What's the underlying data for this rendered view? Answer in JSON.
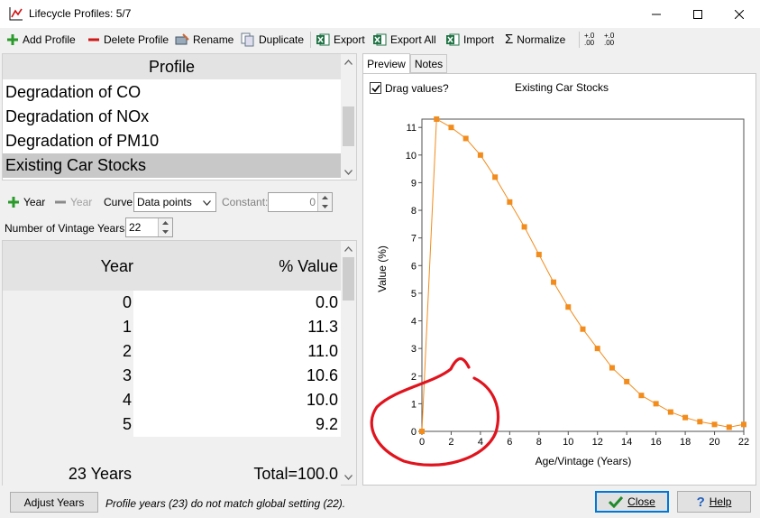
{
  "window": {
    "title": "Lifecycle Profiles: 5/7"
  },
  "toolbar": {
    "add_profile": "Add Profile",
    "delete_profile": "Delete Profile",
    "rename": "Rename",
    "duplicate": "Duplicate",
    "export": "Export",
    "export_all": "Export All",
    "import": "Import",
    "normalize": "Normalize",
    "dec_decimals": "+.0 .00",
    "inc_decimals": "+.0 .00"
  },
  "profiles": {
    "header": "Profile",
    "items": [
      "Degradation of CO",
      "Degradation of NOx",
      "Degradation of PM10",
      "Existing Car Stocks"
    ],
    "selected_index": 3
  },
  "year_toolbar": {
    "add_year": "Year",
    "remove_year": "Year",
    "curve_label": "Curve:",
    "curve_value": "Data points",
    "constant_label": "Constant:",
    "constant_value": "0"
  },
  "vintage": {
    "label": "Number of Vintage Years:",
    "value": "22"
  },
  "table": {
    "col_year": "Year",
    "col_value": "% Value",
    "rows": [
      {
        "year": "0",
        "value": "0.0"
      },
      {
        "year": "1",
        "value": "11.3"
      },
      {
        "year": "2",
        "value": "11.0"
      },
      {
        "year": "3",
        "value": "10.6"
      },
      {
        "year": "4",
        "value": "10.0"
      },
      {
        "year": "5",
        "value": "9.2"
      }
    ],
    "footer_years": "23 Years",
    "footer_total": "Total=100.0"
  },
  "tabs": {
    "preview": "Preview",
    "notes": "Notes"
  },
  "preview": {
    "drag_label": "Drag values?",
    "drag_checked": true
  },
  "chart_data": {
    "type": "line",
    "title": "Existing Car Stocks",
    "xlabel": "Age/Vintage (Years)",
    "ylabel": "Value (%)",
    "xlim": [
      0,
      22
    ],
    "ylim": [
      0,
      11.3
    ],
    "xticks": [
      0,
      2,
      4,
      6,
      8,
      10,
      12,
      14,
      16,
      18,
      20,
      22
    ],
    "yticks": [
      0,
      1,
      2,
      3,
      4,
      5,
      6,
      7,
      8,
      9,
      10,
      11
    ],
    "series": [
      {
        "color": "#f28c1c",
        "x": [
          0,
          1,
          2,
          3,
          4,
          5,
          6,
          7,
          8,
          9,
          10,
          11,
          12,
          13,
          14,
          15,
          16,
          17,
          18,
          19,
          20,
          21,
          22
        ],
        "y": [
          0.0,
          11.3,
          11.0,
          10.6,
          10.0,
          9.2,
          8.3,
          7.4,
          6.4,
          5.4,
          4.5,
          3.7,
          3.0,
          2.3,
          1.8,
          1.3,
          1.0,
          0.7,
          0.5,
          0.35,
          0.25,
          0.15,
          0.25
        ]
      }
    ]
  },
  "status": {
    "adjust_years": "Adjust Years",
    "message": "Profile years (23) do not match global setting (22).",
    "close": "Close",
    "help": "Help"
  }
}
